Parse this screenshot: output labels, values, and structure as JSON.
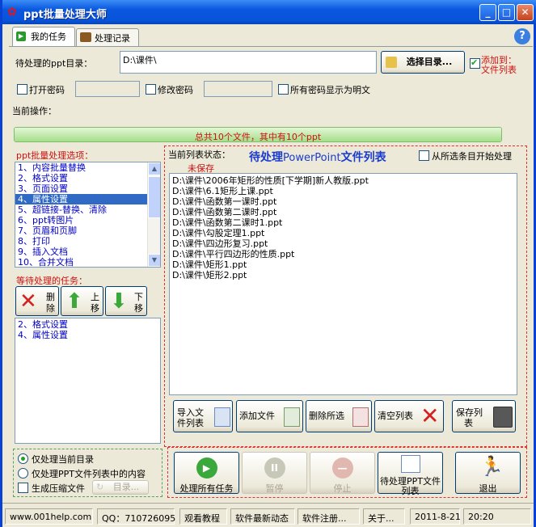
{
  "window": {
    "title": "ppt批量处理大师",
    "minimize": "_",
    "maximize": "□",
    "close": "✕"
  },
  "tabs": [
    {
      "label": "我的任务"
    },
    {
      "label": "处理记录"
    }
  ],
  "help_symbol": "?",
  "dir": {
    "label": "待处理的ppt目录：",
    "value": "D:\\课件\\",
    "select_button": "选择目录...",
    "add_to_list_line1": "添加到：",
    "add_to_list_line2": "文件列表"
  },
  "passwords": {
    "open_label": "打开密码",
    "modify_label": "修改密码",
    "show_plain_label": "所有密码显示为明文"
  },
  "current_op_label": "当前操作：",
  "progress": {
    "text": "总共10个文件，其中有10个ppt",
    "fraction": 1.0
  },
  "options": {
    "label": "ppt批量处理选项：",
    "items": [
      "1、内容批量替换",
      "2、格式设置",
      "3、页面设置",
      "4、属性设置",
      "5、超链接-替换、清除",
      "6、ppt转图片",
      "7、页眉和页脚",
      "8、打印",
      "9、插入文档",
      "10、合并文档"
    ],
    "selected": 3
  },
  "pending": {
    "label": "等待处理的任务：",
    "delete": [
      "删",
      "除"
    ],
    "up": [
      "上",
      "移"
    ],
    "down": [
      "下",
      "移"
    ],
    "items": [
      "2、格式设置",
      "4、属性设置"
    ]
  },
  "filelist": {
    "status_label": "当前列表状态：",
    "unsaved": "未保存",
    "title_prefix": "待处理",
    "title_mid": "PowerPoint",
    "title_suffix": "文件列表",
    "from_selected_label": "从所选条目开始处理",
    "files": [
      "D:\\课件\\2006年矩形的性质[下学期]新人教版.ppt",
      "D:\\课件\\6.1矩形上课.ppt",
      "D:\\课件\\函数第一课时.ppt",
      "D:\\课件\\函数第二课时.ppt",
      "D:\\课件\\函数第二课时1.ppt",
      "D:\\课件\\勾股定理1.ppt",
      "D:\\课件\\四边形复习.ppt",
      "D:\\课件\\平行四边形的性质.ppt",
      "D:\\课件\\矩形1.ppt",
      "D:\\课件\\矩形2.ppt"
    ],
    "import_line1": "导入文",
    "import_line2": "件列表",
    "add_file": "添加文件",
    "delete_selected": "删除所选",
    "clear_list": "清空列表",
    "save_line1": "保存列",
    "save_line2": "表"
  },
  "scope": {
    "current_dir": "仅处理当前目录",
    "ppt_list": "仅处理PPT文件列表中的内容",
    "zip_label": "生成压缩文件",
    "dir_button": "目录..."
  },
  "actions": {
    "process_all": "处理所有任务",
    "pause": "暂停",
    "stop": "停止",
    "pending_list_line1": "待处理PPT文件",
    "pending_list_line2": "列表",
    "exit": "退出"
  },
  "statusbar": {
    "site": "www.001help.com",
    "qq": "QQ：710726095",
    "tutorial": "观看教程",
    "news": "软件最新动态",
    "register": "软件注册...",
    "about": "关于...",
    "date": "2011-8-21",
    "time": "20:20"
  }
}
